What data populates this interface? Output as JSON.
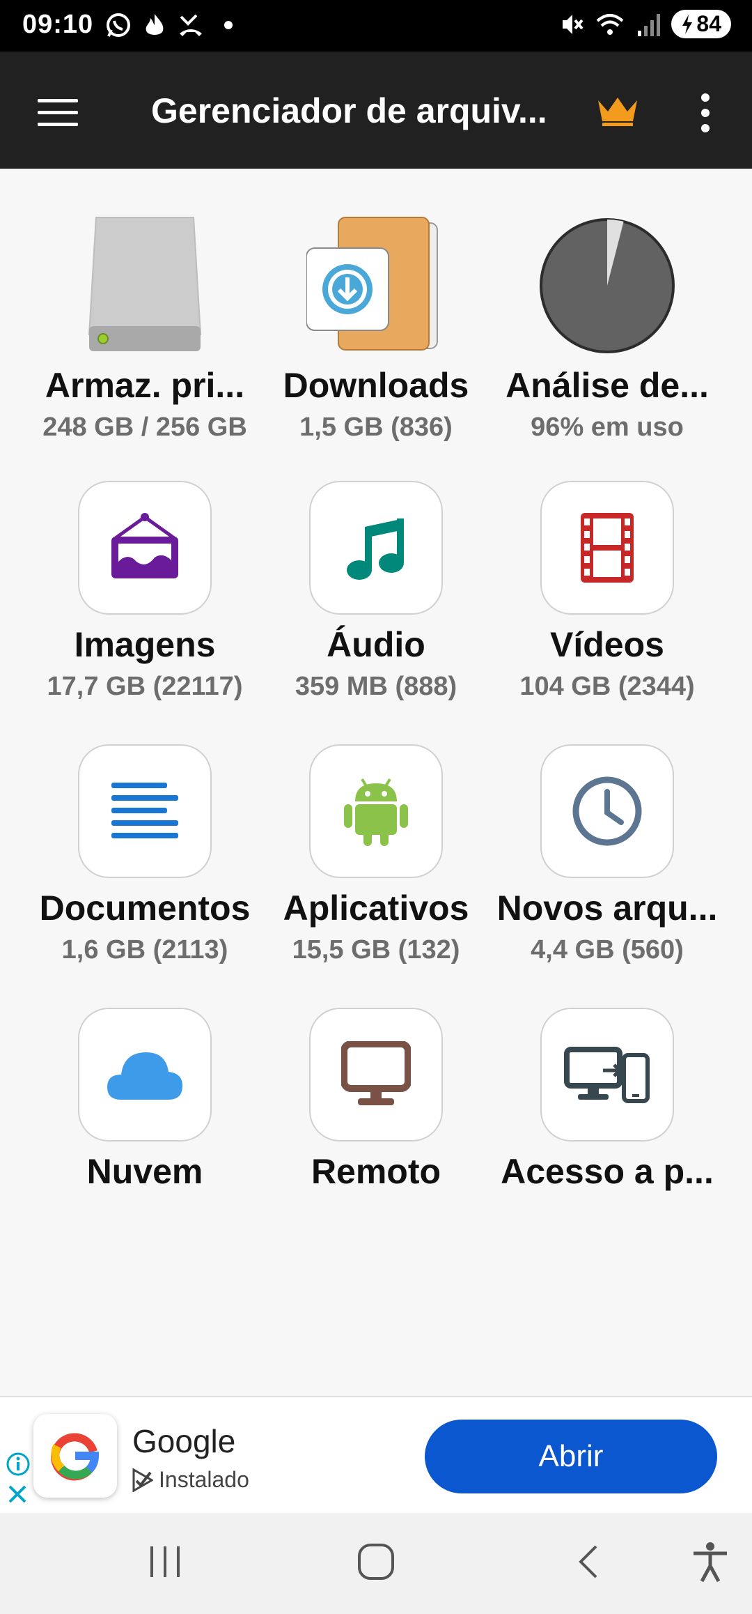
{
  "status_bar": {
    "time": "09:10",
    "battery": "84",
    "icons": [
      "whatsapp-icon",
      "fire-icon",
      "missed-call-icon",
      "dot-icon",
      "mute-icon",
      "wifi-icon",
      "signal-icon",
      "battery-icon"
    ]
  },
  "app_bar": {
    "title": "Gerenciador de arquiv...",
    "icons": [
      "menu-icon",
      "crown-icon",
      "more-vert-icon"
    ],
    "crown_color": "#f29b1d"
  },
  "grid": [
    {
      "label": "Armaz. pri...",
      "sub": "248 GB / 256 GB",
      "icon": "storage-drive-icon"
    },
    {
      "label": "Downloads",
      "sub": "1,5 GB (836)",
      "icon": "downloads-folder-icon"
    },
    {
      "label": "Análise de...",
      "sub": "96% em uso",
      "icon": "pie-usage-icon",
      "usage_fraction": 0.96
    },
    {
      "label": "Imagens",
      "sub": "17,7 GB (22117)",
      "icon": "picture-frame-icon"
    },
    {
      "label": "Áudio",
      "sub": "359 MB (888)",
      "icon": "music-note-icon"
    },
    {
      "label": "Vídeos",
      "sub": "104 GB (2344)",
      "icon": "film-strip-icon"
    },
    {
      "label": "Documentos",
      "sub": "1,6 GB (2113)",
      "icon": "document-lines-icon"
    },
    {
      "label": "Aplicativos",
      "sub": "15,5 GB (132)",
      "icon": "android-icon"
    },
    {
      "label": "Novos arqu...",
      "sub": "4,4 GB (560)",
      "icon": "clock-icon"
    },
    {
      "label": "Nuvem",
      "icon": "cloud-icon"
    },
    {
      "label": "Remoto",
      "icon": "monitor-icon"
    },
    {
      "label": "Acesso a p...",
      "icon": "pc-phone-access-icon"
    }
  ],
  "ad": {
    "app_name": "Google",
    "status": "Instalado",
    "button": "Abrir",
    "button_color": "#0b57d0"
  },
  "nav_bar": {
    "icons": [
      "recents-icon",
      "home-icon",
      "back-icon",
      "accessibility-icon"
    ]
  }
}
